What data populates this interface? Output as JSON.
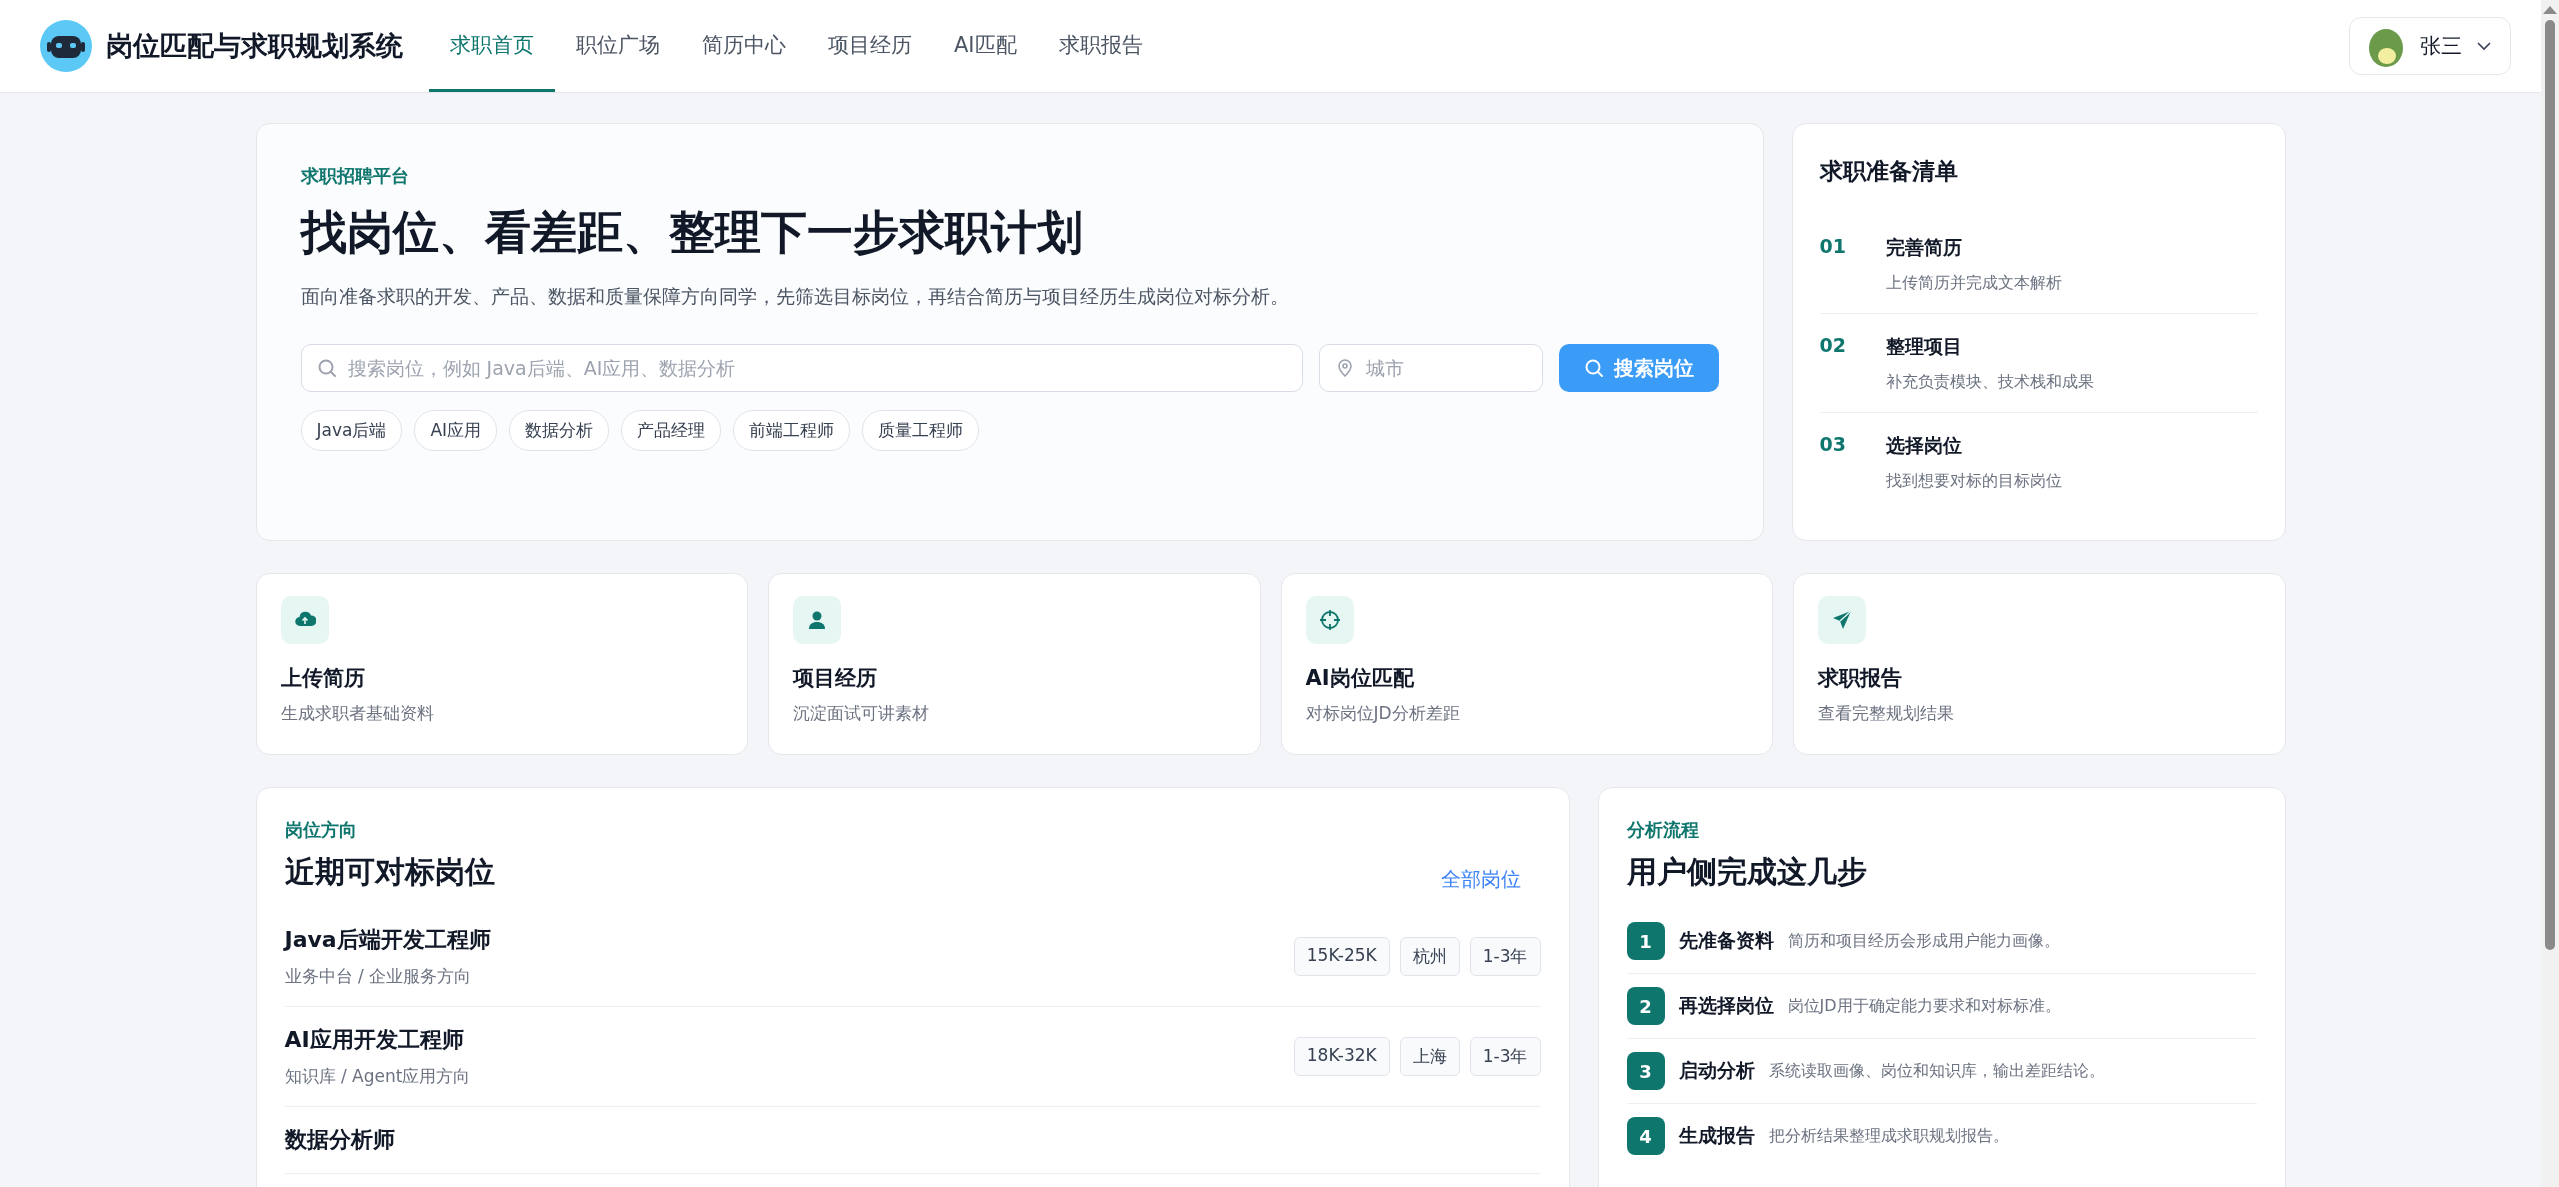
{
  "header": {
    "title": "岗位匹配与求职规划系统",
    "nav": [
      {
        "label": "求职首页",
        "selected": true
      },
      {
        "label": "职位广场",
        "selected": false
      },
      {
        "label": "简历中心",
        "selected": false
      },
      {
        "label": "项目经历",
        "selected": false
      },
      {
        "label": "AI匹配",
        "selected": false
      },
      {
        "label": "求职报告",
        "selected": false
      }
    ],
    "user": {
      "name": "张三"
    }
  },
  "hero": {
    "eyebrow": "求职招聘平台",
    "title": "找岗位、看差距、整理下一步求职计划",
    "description": "面向准备求职的开发、产品、数据和质量保障方向同学，先筛选目标岗位，再结合简历与项目经历生成岗位对标分析。",
    "search": {
      "placeholder": "搜索岗位，例如 Java后端、AI应用、数据分析"
    },
    "city": {
      "placeholder": "城市"
    },
    "search_button": "搜索岗位",
    "tags": [
      "Java后端",
      "AI应用",
      "数据分析",
      "产品经理",
      "前端工程师",
      "质量工程师"
    ]
  },
  "checklist": {
    "title": "求职准备清单",
    "items": [
      {
        "number": "01",
        "title": "完善简历",
        "description": "上传简历并完成文本解析"
      },
      {
        "number": "02",
        "title": "整理项目",
        "description": "补充负责模块、技术栈和成果"
      },
      {
        "number": "03",
        "title": "选择岗位",
        "description": "找到想要对标的目标岗位"
      }
    ]
  },
  "shortcuts": [
    {
      "kind": "upload",
      "title": "上传简历",
      "description": "生成求职者基础资料"
    },
    {
      "kind": "person",
      "title": "项目经历",
      "description": "沉淀面试可讲素材"
    },
    {
      "kind": "target",
      "title": "AI岗位匹配",
      "description": "对标岗位JD分析差距"
    },
    {
      "kind": "send",
      "title": "求职报告",
      "description": "查看完整规划结果"
    }
  ],
  "jobs": {
    "eyebrow": "岗位方向",
    "title": "近期可对标岗位",
    "link": "全部岗位",
    "rows": [
      {
        "title": "Java后端开发工程师",
        "subtitle": "业务中台 / 企业服务方向",
        "tags": [
          "15K-25K",
          "杭州",
          "1-3年"
        ]
      },
      {
        "title": "AI应用开发工程师",
        "subtitle": "知识库 / Agent应用方向",
        "tags": [
          "18K-32K",
          "上海",
          "1-3年"
        ]
      },
      {
        "title": "数据分析师"
      }
    ]
  },
  "process": {
    "eyebrow": "分析流程",
    "title": "用户侧完成这几步",
    "steps": [
      {
        "number": "1",
        "title": "先准备资料",
        "description": "简历和项目经历会形成用户能力画像。"
      },
      {
        "number": "2",
        "title": "再选择岗位",
        "description": "岗位JD用于确定能力要求和对标标准。"
      },
      {
        "number": "3",
        "title": "启动分析",
        "description": "系统读取画像、岗位和知识库，输出差距结论。"
      },
      {
        "number": "4",
        "title": "生成报告",
        "description": "把分析结果整理成求职规划报告。"
      }
    ]
  }
}
